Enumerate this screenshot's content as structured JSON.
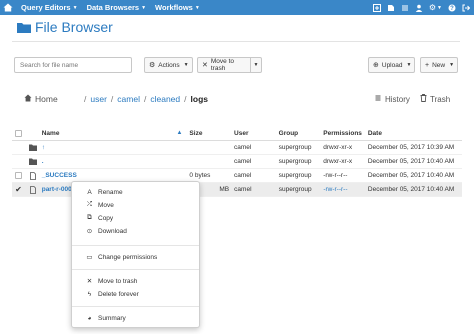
{
  "navbar": {
    "menus": [
      {
        "label": "Query Editors"
      },
      {
        "label": "Data Browsers"
      },
      {
        "label": "Workflows"
      }
    ],
    "bg_color": "#3a87c8"
  },
  "page": {
    "title": "File Browser",
    "accent_color": "#2c7bc0"
  },
  "toolbar": {
    "search_placeholder": "Search for file name",
    "actions_label": "Actions",
    "move_to_trash_label": "Move to trash",
    "upload_label": "Upload",
    "new_label": "New"
  },
  "breadcrumb": {
    "home_label": "Home",
    "sep": "/",
    "parts": [
      "user",
      "camel",
      "cleaned"
    ],
    "current": "logs",
    "history_label": "History",
    "trash_label": "Trash"
  },
  "table": {
    "columns": {
      "name": "Name",
      "size": "Size",
      "user": "User",
      "group": "Group",
      "permissions": "Permissions",
      "date": "Date"
    },
    "rows": [
      {
        "icon": "folder-icon",
        "name": "↑",
        "size": "",
        "user": "camel",
        "group": "supergroup",
        "permissions": "drwxr-xr-x",
        "date": "December 05, 2017 10:39 AM"
      },
      {
        "icon": "folder-icon",
        "name": ".",
        "size": "",
        "user": "camel",
        "group": "supergroup",
        "permissions": "drwxr-xr-x",
        "date": "December 05, 2017 10:40 AM"
      },
      {
        "icon": "file-icon",
        "name": "_SUCCESS",
        "size": "0 bytes",
        "user": "camel",
        "group": "supergroup",
        "permissions": "-rw-r--r--",
        "date": "December 05, 2017 10:40 AM"
      },
      {
        "icon": "file-icon",
        "name": "part-r-000",
        "size": "MB",
        "user": "camel",
        "group": "supergroup",
        "permissions": "-rw-r--r--",
        "date": "December 05, 2017 10:40 AM"
      }
    ]
  },
  "context_menu": {
    "items": [
      {
        "label": "Rename",
        "icon": "text-cursor-icon"
      },
      {
        "label": "Move",
        "icon": "move-icon"
      },
      {
        "label": "Copy",
        "icon": "copy-icon"
      },
      {
        "label": "Download",
        "icon": "download-icon"
      },
      {
        "label": "Change permissions",
        "icon": "key-icon"
      },
      {
        "label": "Move to trash",
        "icon": "times-icon"
      },
      {
        "label": "Delete forever",
        "icon": "bolt-icon"
      },
      {
        "label": "Summary",
        "icon": "pie-chart-icon"
      }
    ]
  }
}
